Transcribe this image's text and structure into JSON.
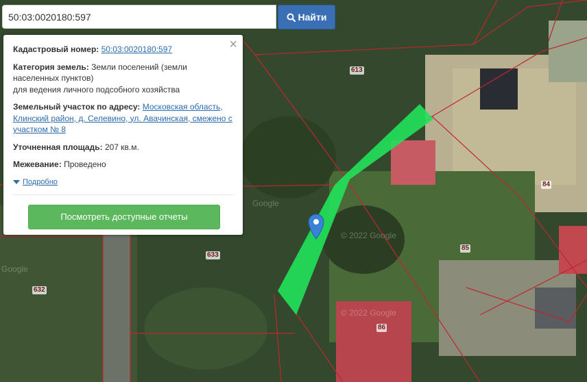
{
  "search": {
    "value": "50:03:0020180:597",
    "button_label": "Найти",
    "button_color": "#3a6fb5"
  },
  "popup": {
    "cadastral_label": "Кадастровый номер:",
    "cadastral_value": "50:03:0020180:597",
    "category_label": "Категория земель:",
    "category_value_1": "Земли поселений (земли",
    "category_value_2": "населенных пунктов)",
    "category_value_3": "для ведения личного подсобного хозяйства",
    "address_label": "Земельный участок по адресу:",
    "address_value_1": "Московская область,",
    "address_value_2": "Клинский район, д. Селевино, ул. Авачинская, смежено с",
    "address_value_3": "участком № 8",
    "area_label": "Уточненная площадь:",
    "area_value": "207 кв.м.",
    "survey_label": "Межевание:",
    "survey_value": "Проведено",
    "more_label": "Подробно",
    "reports_button": "Посмотреть доступные отчеты",
    "reports_color": "#5cb85c"
  },
  "map": {
    "plot_numbers": [
      "613",
      "84",
      "633",
      "85",
      "632",
      "86"
    ],
    "watermarks": [
      "Google",
      "© 2022 Google",
      "© 2022 Google",
      "Google"
    ],
    "highlight_color": "#22e05a",
    "boundary_color": "#c0272d",
    "marker_icon": "map-pin-icon"
  }
}
